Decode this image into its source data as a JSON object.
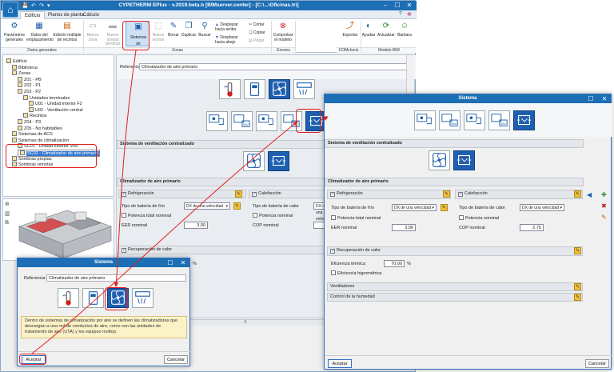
{
  "window": {
    "title": "CYPETHERM EPlus - v.2019.beta.b [BIMserver.center] - [C:\\...\\Oficinas.tri]",
    "quick_access": [
      "💾",
      "↶",
      "↷",
      "▾"
    ],
    "controls": {
      "minimize": "–",
      "maximize": "☐",
      "close": "✕"
    }
  },
  "tabs": [
    "Edificio",
    "Planos de planta",
    "Cálculo"
  ],
  "ribbon": {
    "groups": [
      {
        "label": "Datos generales"
      },
      {
        "label": "Zonas"
      },
      {
        "label": "Errores"
      },
      {
        "label": "COMcheck"
      },
      {
        "label": "Modelo BIM"
      }
    ],
    "buttons": {
      "parametros": "Parámetros generales",
      "datos": "Datos del emplazamiento",
      "edicion": "Edición múltiple de recintos",
      "nueva_zona": "Nueva zona",
      "nueva_unidad": "Nueva unidad terminal",
      "sistemas": "Sistemas de climatización",
      "nuevo_recinto": "Nuevo recinto",
      "borrar": "Borrar",
      "duplicar": "Duplicar",
      "buscar": "Buscar",
      "desplazar_arriba": "Desplazar hacia arriba",
      "desplazar_abajo": "Desplazar hacia abajo",
      "cortar": "Cortar",
      "copiar": "Copiar",
      "pegar": "Pegar",
      "comprobar": "Comprobar el modelo",
      "exportar": "Exportar",
      "ayudas": "Ayudas",
      "actualizar": "Actualizar",
      "bimserver": "Bárbara"
    }
  },
  "tree": {
    "items": [
      {
        "label": "Edificio",
        "indent": 0
      },
      {
        "label": "Biblioteca",
        "indent": 1
      },
      {
        "label": "Zonas",
        "indent": 1
      },
      {
        "label": "Z01 - PB",
        "indent": 2
      },
      {
        "label": "Z02 - P1",
        "indent": 2
      },
      {
        "label": "Z03 - P2",
        "indent": 2
      },
      {
        "label": "Unidades terminales",
        "indent": 3
      },
      {
        "label": "U01 - Unidad interior F2",
        "indent": 4
      },
      {
        "label": "U02 - Ventilación central",
        "indent": 4
      },
      {
        "label": "Recintos",
        "indent": 3
      },
      {
        "label": "Z04 - P3",
        "indent": 2
      },
      {
        "label": "Z05 - No habitables",
        "indent": 2
      },
      {
        "label": "Sistemas de ACS",
        "indent": 1
      },
      {
        "label": "Sistemas de climatización",
        "indent": 1
      },
      {
        "label": "SC01 - Unidad exterior VRF",
        "indent": 2
      },
      {
        "label": "SC02 - Climatizador de aire primario",
        "indent": 2
      },
      {
        "label": "Sombras propias",
        "indent": 1
      },
      {
        "label": "Sombras remotas",
        "indent": 1
      }
    ]
  },
  "main_panel": {
    "referencia_label": "Referencia",
    "referencia_value": "Climatizador de aire primario",
    "section_ventilacion": "Sistema de ventilación centralizado",
    "section_climatizador": "Climatizador de aire primario",
    "refrigeracion": "Refrigeración",
    "calefaccion": "Calefacción",
    "tipo_frio_label": "Tipo de batería de frío",
    "tipo_calor_label": "Tipo de batería de calor",
    "tipo_value": "DX de una velocidad",
    "potencia_total": "Potencia total nominal",
    "potencia_nominal": "Potencia nominal",
    "eer_label": "EER nominal",
    "eer_value": "3.00",
    "cop_label": "COP nominal",
    "recuperacion": "Recuperación de calor",
    "percent": "%"
  },
  "dialog_big": {
    "title": "Sistema",
    "section_ventilacion": "Sistema de ventilación centralizado",
    "section_climatizador": "Climatizador de aire primario",
    "refrigeracion": "Refrigeración",
    "calefaccion": "Calefacción",
    "tipo_frio_label": "Tipo de batería de frío",
    "tipo_calor_label": "Tipo de batería de calor",
    "tipo_value": "DX de una velocidad",
    "potencia_total": "Potencia total nominal",
    "potencia_nominal": "Potencia nominal",
    "eer_label": "EER nominal",
    "eer_value": "3.00",
    "cop_label": "COP nominal",
    "cop_value": "2.75",
    "recuperacion": "Recuperación de calor",
    "eficiencia_label": "Eficiencia térmica",
    "eficiencia_value": "70.00",
    "percent": "%",
    "eficiencia_higro": "Eficiencia higrométrica",
    "ventiladores": "Ventiladores",
    "control_humedad": "Control de la humedad",
    "aceptar": "Aceptar",
    "cancelar": "Cancelar"
  },
  "dialog_small": {
    "title": "Sistema",
    "referencia_label": "Referencia",
    "referencia_value": "Climatizador de aire primario",
    "info": "Dentro de sistemas de climatización por aire se definen las climatizadoras que descargan a una red de conductos de aire, como son las unidades de tratamiento de aire (UTA) y los equipos rooftop.",
    "aceptar": "Aceptar",
    "cancelar": "Cancelar"
  }
}
